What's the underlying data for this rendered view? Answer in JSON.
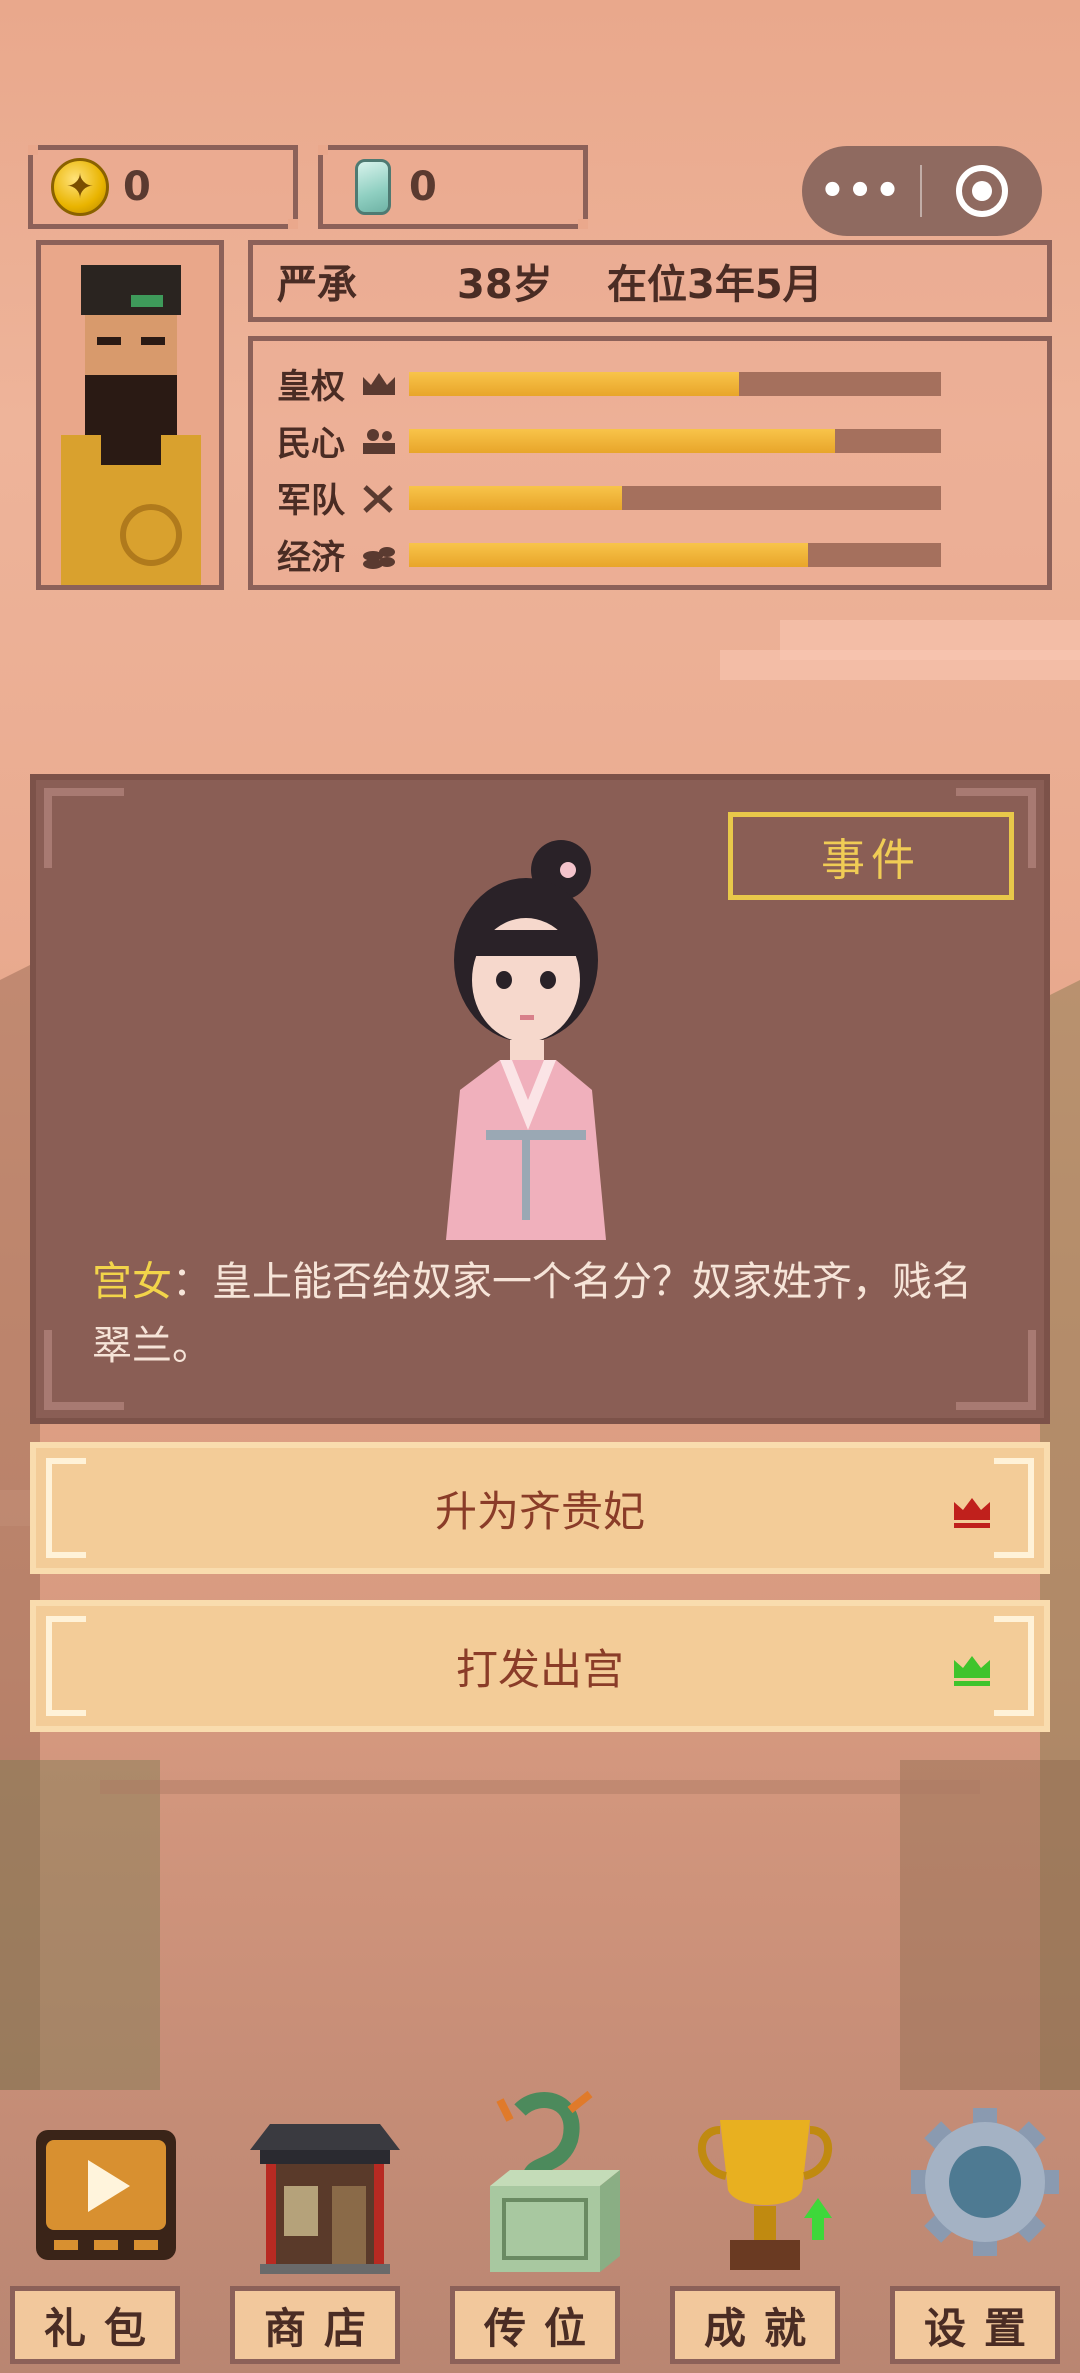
{
  "currencies": [
    {
      "name": "gold",
      "value": "0"
    },
    {
      "name": "jade",
      "value": "0"
    }
  ],
  "capsule": {
    "more": "•••"
  },
  "emperor": {
    "name": "严承",
    "age": "38岁",
    "reign": "在位3年5月"
  },
  "stats": [
    {
      "label": "皇权",
      "icon": "crown-icon",
      "level": 0.62
    },
    {
      "label": "民心",
      "icon": "people-icon",
      "level": 0.8
    },
    {
      "label": "军队",
      "icon": "swords-icon",
      "level": 0.4
    },
    {
      "label": "经济",
      "icon": "coins-icon",
      "level": 0.75
    }
  ],
  "event": {
    "tag": "事件",
    "speaker": "宫女",
    "separator": "：",
    "text": "皇上能否给奴家一个名分？奴家姓齐，贱名翠兰。"
  },
  "choices": [
    {
      "label": "升为齐贵妃",
      "crown_color": "#c0201c"
    },
    {
      "label": "打发出宫",
      "crown_color": "#3fc42c"
    }
  ],
  "nav": [
    {
      "label": "礼包",
      "icon": "gift-video-icon"
    },
    {
      "label": "商店",
      "icon": "shop-icon"
    },
    {
      "label": "传位",
      "icon": "jade-seal-icon"
    },
    {
      "label": "成就",
      "icon": "trophy-icon"
    },
    {
      "label": "设置",
      "icon": "gear-icon"
    }
  ],
  "colors": {
    "bar_fill": "#f3b93a",
    "card_bg": "#8a5e55",
    "event_tag": "#f0cc55",
    "speaker": "#f2d44a",
    "choice_bg": "#f3cc98"
  }
}
